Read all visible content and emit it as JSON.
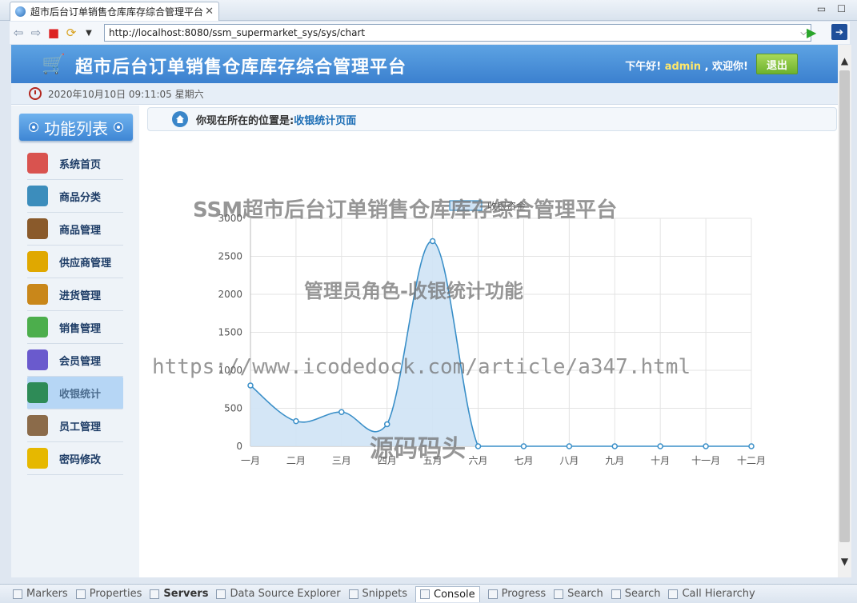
{
  "browser": {
    "tab_title": "超市后台订单销售仓库库存综合管理平台",
    "tab_close": "✕",
    "url": "http://localhost:8080/ssm_supermarket_sys/sys/chart",
    "minimize": "▭",
    "maximize": "☐"
  },
  "header": {
    "title": "超市后台订单销售仓库库存综合管理平台",
    "greeting_prefix": "下午好!",
    "username": "admin",
    "greeting_suffix": ", 欢迎你!",
    "logout_label": "退出"
  },
  "datetime": "2020年10月10日 09:11:05 星期六",
  "sidebar": {
    "heading": "功能列表",
    "items": [
      {
        "label": "系统首页",
        "color": "#d9534f"
      },
      {
        "label": "商品分类",
        "color": "#3c8dbc"
      },
      {
        "label": "商品管理",
        "color": "#8a5a2b"
      },
      {
        "label": "供应商管理",
        "color": "#e0a800"
      },
      {
        "label": "进货管理",
        "color": "#c9871a"
      },
      {
        "label": "销售管理",
        "color": "#4cae4c"
      },
      {
        "label": "会员管理",
        "color": "#6a5acd"
      },
      {
        "label": "收银统计",
        "color": "#2e8b57"
      },
      {
        "label": "员工管理",
        "color": "#8b6b4a"
      },
      {
        "label": "密码修改",
        "color": "#e6b800"
      }
    ],
    "active_index": 7
  },
  "breadcrumb": {
    "prefix": "你现在所在的位置是:",
    "current": "收银统计页面"
  },
  "chart_data": {
    "type": "area",
    "categories": [
      "一月",
      "二月",
      "三月",
      "四月",
      "五月",
      "六月",
      "七月",
      "八月",
      "九月",
      "十月",
      "十一月",
      "十二月"
    ],
    "series": [
      {
        "name": "收银资金",
        "values": [
          800,
          330,
          450,
          290,
          2700,
          0,
          0,
          0,
          0,
          0,
          0,
          0
        ],
        "color": "#3a8fc8",
        "fill": "#cfe3f5"
      }
    ],
    "ylim": [
      0,
      3000
    ],
    "yticks": [
      0,
      500,
      1000,
      1500,
      2000,
      2500,
      3000
    ],
    "grid": true,
    "legend": "top-center"
  },
  "watermarks": [
    "SSM超市后台订单销售仓库库存综合管理平台",
    "管理员角色-收银统计功能",
    "https://www.icodedock.com/article/a347.html",
    "源码码头"
  ],
  "views_bar": {
    "tabs": [
      "Markers",
      "Properties",
      "Servers",
      "Data Source Explorer",
      "Snippets",
      "Console",
      "Progress",
      "Search",
      "Search",
      "Call Hierarchy"
    ],
    "active": "Console"
  }
}
